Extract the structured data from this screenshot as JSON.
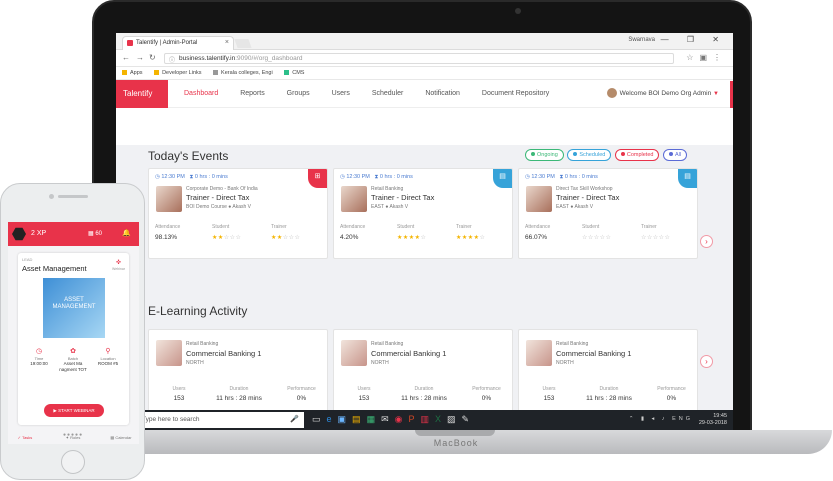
{
  "browser": {
    "tab_title": "Talentify | Admin-Portal",
    "tab_close": "×",
    "window_user": "Swarnava",
    "window_buttons": "— ❐ ✕",
    "url_host": "business.talentify.in",
    "url_path": ":9090/#/org_dashboard",
    "bookmarks": [
      {
        "label": "Apps"
      },
      {
        "label": "Developer Links"
      },
      {
        "label": "Kerala colleges, Engi"
      },
      {
        "label": "CMS"
      }
    ]
  },
  "app": {
    "logo": "Talentify",
    "menu": [
      "Dashboard",
      "Reports",
      "Groups",
      "Users",
      "Scheduler",
      "Notification",
      "Document Repository"
    ],
    "active_menu": "Dashboard",
    "welcome": "Welcome BOI Demo Org Admin"
  },
  "events": {
    "title": "Today's Events",
    "filters": [
      {
        "label": "Ongoing",
        "color": "#3cb878"
      },
      {
        "label": "Scheduled",
        "color": "#36a3d9"
      },
      {
        "label": "Completed",
        "color": "#e8334a"
      },
      {
        "label": "All",
        "color": "#5b6bd6"
      }
    ],
    "cards": [
      {
        "time": "12:30 PM",
        "duration": "0 hrs : 0 mins",
        "subtitle": "Corporate Demo - Bank Of India",
        "name": "Trainer - Direct Tax",
        "meta": "BOI Demo Course ● Akash V",
        "attendance_label": "Attendance",
        "attendance": "98.13%",
        "student_label": "Student",
        "student_rating": 2,
        "trainer_label": "Trainer",
        "trainer_rating": 2,
        "corner_color": "#e8334a",
        "corner_icon": "⊞"
      },
      {
        "time": "12:30 PM",
        "duration": "0 hrs : 0 mins",
        "subtitle": "Retail Banking",
        "name": "Trainer - Direct Tax",
        "meta": "EAST ● Akash V",
        "attendance_label": "Attendance",
        "attendance": "4.20%",
        "student_label": "Student",
        "student_rating": 4,
        "trainer_label": "Trainer",
        "trainer_rating": 4,
        "corner_color": "#36a3d9",
        "corner_icon": "▤"
      },
      {
        "time": "12:30 PM",
        "duration": "0 hrs : 0 mins",
        "subtitle": "Direct Tax Skill Workshop",
        "name": "Trainer - Direct Tax",
        "meta": "EAST ● Akash V",
        "attendance_label": "Attendance",
        "attendance": "66.07%",
        "student_label": "Student",
        "student_rating": 0,
        "trainer_label": "Trainer",
        "trainer_rating": 0,
        "corner_color": "#36a3d9",
        "corner_icon": "▤"
      }
    ]
  },
  "elearning": {
    "title": "E-Learning Activity",
    "cards": [
      {
        "subtitle": "Retail Banking",
        "name": "Commercial Banking 1",
        "region": "NORTH",
        "users_label": "Users",
        "users": "153",
        "duration_label": "Duration",
        "duration": "11 hrs : 28 mins",
        "performance_label": "Performance",
        "performance": "0%"
      },
      {
        "subtitle": "Retail Banking",
        "name": "Commercial Banking 1",
        "region": "NORTH",
        "users_label": "Users",
        "users": "153",
        "duration_label": "Duration",
        "duration": "11 hrs : 28 mins",
        "performance_label": "Performance",
        "performance": "0%"
      },
      {
        "subtitle": "Retail Banking",
        "name": "Commercial Banking 1",
        "region": "NORTH",
        "users_label": "Users",
        "users": "153",
        "duration_label": "Duration",
        "duration": "11 hrs : 28 mins",
        "performance_label": "Performance",
        "performance": "0%"
      }
    ]
  },
  "taskbar": {
    "search_placeholder": "Type here to search",
    "lang": "ENG",
    "time": "19:45",
    "date": "29-03-2018"
  },
  "laptop_brand": "MacBook",
  "phone": {
    "xp": "2 XP",
    "count": "60",
    "tag": "LEAD",
    "title": "Asset Management",
    "webinar_label": "Webinar",
    "image_text": "ASSET MANAGEMENT",
    "info": [
      {
        "label": "Time",
        "value": "19:00:00"
      },
      {
        "label": "Batch",
        "value": "Asset Ma nagment TOT"
      },
      {
        "label": "Location",
        "value": "ROOM #5"
      }
    ],
    "button": "START WEBINAR",
    "tabs": [
      "Tasks",
      "Roles",
      "Calendar"
    ],
    "active_tab": "Tasks"
  },
  "colors": {
    "brand": "#e8334a",
    "star": "#f4b400",
    "link": "#4a7bd0"
  }
}
